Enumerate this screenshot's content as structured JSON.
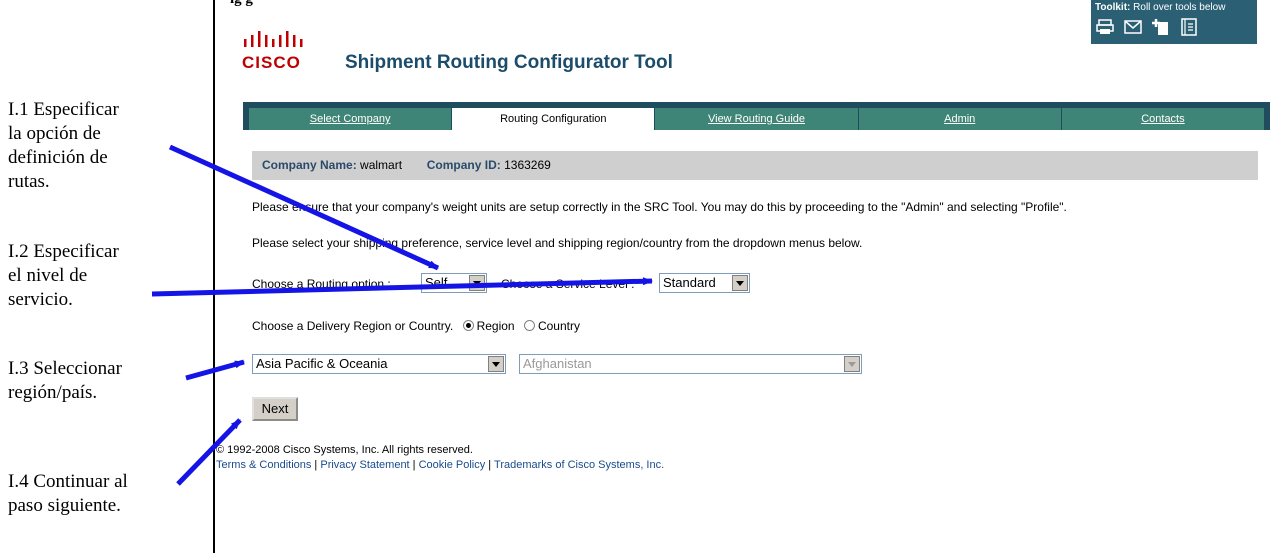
{
  "document": {
    "heading_fragment": "ig                                  g"
  },
  "annotations": [
    {
      "id": "I.1",
      "lines": [
        "I.1 Especificar",
        "la opción de",
        "definición de",
        "rutas."
      ]
    },
    {
      "id": "I.2",
      "lines": [
        "I.2 Especificar",
        "el nivel de",
        "servicio."
      ]
    },
    {
      "id": "I.3",
      "lines": [
        "I.3 Seleccionar",
        "región/país."
      ]
    },
    {
      "id": "I.4",
      "lines": [
        "I.4 Continuar al",
        "paso siguiente."
      ]
    }
  ],
  "header": {
    "logo_text": "CISCO",
    "app_title": "Shipment Routing Configurator Tool"
  },
  "toolkit": {
    "title": "Toolkit:",
    "subtitle": "Roll over tools below",
    "icons": [
      "printer-icon",
      "email-icon",
      "add-bookmark-icon",
      "document-icon"
    ]
  },
  "nav": {
    "tabs": [
      "Select Company",
      "Routing Configuration",
      "View Routing Guide",
      "Admin",
      "Contacts"
    ],
    "active_index": 1
  },
  "company": {
    "name_label": "Company Name:",
    "name_value": "walmart",
    "id_label": "Company ID:",
    "id_value": "1363269"
  },
  "content": {
    "notice": "Please ensure that your company's weight units are setup correctly in the SRC Tool. You may do this by proceeding to the \"Admin\" and selecting \"Profile\".",
    "instruction": "Please select your shipping preference, service level and shipping region/country from the dropdown menus below.",
    "routing_label": "Choose a Routing option :",
    "routing_value": "Self",
    "service_label": "Choose a Service Level :",
    "service_value": "Standard",
    "delivery_label": "Choose a Delivery Region or Country.",
    "radio_region": "Region",
    "radio_country": "Country",
    "region_value": "Asia Pacific & Oceania",
    "country_value": "Afghanistan",
    "next_button": "Next"
  },
  "footer": {
    "copyright": "© 1992-2008 Cisco Systems, Inc. All rights reserved.",
    "links": [
      "Terms & Conditions",
      "Privacy Statement",
      "Cookie Policy",
      "Trademarks of Cisco Systems, Inc."
    ]
  },
  "colors": {
    "arrow": "#1414e6",
    "nav_bar": "#1f4d5e",
    "tab": "#3f8577",
    "title": "#1c4c6b",
    "logo": "#c00000"
  }
}
